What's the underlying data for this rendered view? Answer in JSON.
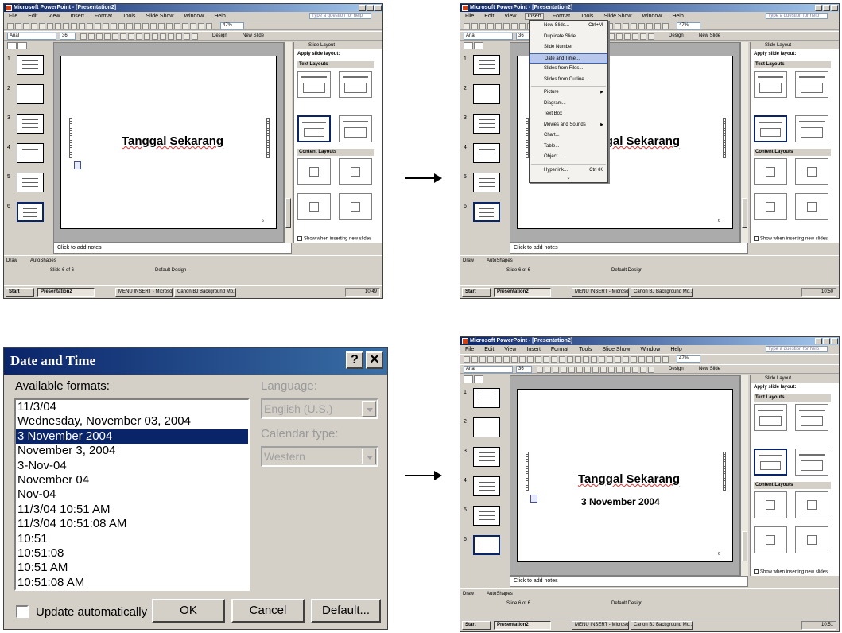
{
  "ppt": {
    "window_title": "Microsoft PowerPoint - [Presentation2]",
    "menus": [
      "File",
      "Edit",
      "View",
      "Insert",
      "Format",
      "Tools",
      "Slide Show",
      "Window",
      "Help"
    ],
    "help_placeholder": "Type a question for help",
    "font_name": "Arial",
    "font_size": "36",
    "zoom": "47%",
    "design_label": "Design",
    "new_slide_label": "New Slide",
    "slide_title": "Tanggal Sekarang",
    "inserted_date": "3 November 2004",
    "page_number": "6",
    "notes_placeholder": "Click to add notes",
    "task_pane": {
      "title": "Slide Layout",
      "apply_label": "Apply slide layout:",
      "text_layouts": "Text Layouts",
      "content_layouts": "Content Layouts",
      "show_check": "Show when inserting new slides"
    },
    "draw_label": "Draw",
    "autoshapes_label": "AutoShapes",
    "status": {
      "slide": "Slide 6 of 6",
      "design": "Default Design"
    },
    "taskbar": {
      "start": "Start",
      "tasks": [
        "Presentation2",
        "MENU INSERT - Microsoft...",
        "Canon BJ Background Mo..."
      ],
      "clock_1": "10:49",
      "clock_2": "10:50",
      "clock_3": "10:51"
    },
    "thumb_numbers": [
      "1",
      "2",
      "3",
      "4",
      "5",
      "6"
    ],
    "insert_menu": {
      "items": [
        {
          "label": "New Slide...",
          "shortcut": "Ctrl+M"
        },
        {
          "label": "Duplicate Slide",
          "shortcut": ""
        },
        {
          "label": "Slide Number",
          "shortcut": ""
        },
        {
          "label": "Date and Time...",
          "shortcut": ""
        },
        {
          "label": "Slides from Files...",
          "shortcut": ""
        },
        {
          "label": "Slides from Outline...",
          "shortcut": ""
        },
        {
          "label": "Picture",
          "shortcut": ""
        },
        {
          "label": "Diagram...",
          "shortcut": ""
        },
        {
          "label": "Text Box",
          "shortcut": ""
        },
        {
          "label": "Movies and Sounds",
          "shortcut": ""
        },
        {
          "label": "Chart...",
          "shortcut": ""
        },
        {
          "label": "Table...",
          "shortcut": ""
        },
        {
          "label": "Object...",
          "shortcut": ""
        },
        {
          "label": "Hyperlink...",
          "shortcut": "Ctrl+K"
        }
      ]
    }
  },
  "dialog": {
    "title": "Date and Time",
    "help_btn": "?",
    "close_btn": "✕",
    "available_formats_label": "Available formats:",
    "formats": [
      "11/3/04",
      "Wednesday, November 03, 2004",
      "3 November 2004",
      "November 3, 2004",
      "3-Nov-04",
      "November 04",
      "Nov-04",
      "11/3/04 10:51 AM",
      "11/3/04 10:51:08 AM",
      "10:51",
      "10:51:08",
      "10:51 AM",
      "10:51:08 AM"
    ],
    "selected_format": "3 November 2004",
    "language_label": "Language:",
    "language_value": "English (U.S.)",
    "calendar_label": "Calendar type:",
    "calendar_value": "Western",
    "update_auto_label": "Update automatically",
    "ok_label": "OK",
    "cancel_label": "Cancel",
    "default_label": "Default..."
  }
}
